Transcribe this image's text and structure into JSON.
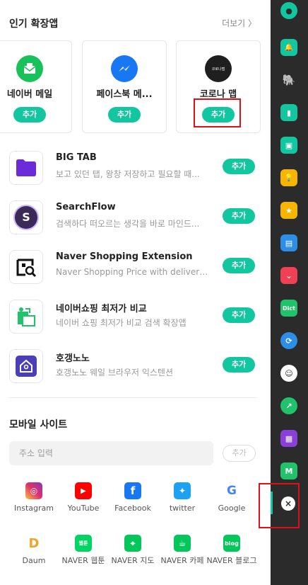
{
  "popular": {
    "title": "인기 확장앱",
    "more": "더보기 〉",
    "cards": [
      {
        "name": "네이버 메일",
        "button": "추가",
        "color": "#19c15a"
      },
      {
        "name": "페이스북 메...",
        "button": "추가",
        "color": "#1877f2"
      },
      {
        "name": "코로나 맵",
        "button": "추가",
        "color": "#1f1f1f",
        "icon_text": "코로나맵"
      }
    ]
  },
  "list": [
    {
      "title": "BIG TAB",
      "desc": "보고 있던 탭, 왕창 저장하고 필요할 때...",
      "button": "추가"
    },
    {
      "title": "SearchFlow",
      "desc": "검색하다 떠오르는 생각을 바로 마인드...",
      "button": "추가"
    },
    {
      "title": "Naver Shopping Extension",
      "desc": "Naver Shopping Price with delivery pr...",
      "button": "추가"
    },
    {
      "title": "네이버쇼핑 최저가 비교",
      "desc": "네이버 쇼핑 최저가 비교 검색 확장앱",
      "button": "추가"
    },
    {
      "title": "호갱노노",
      "desc": "호갱노노 웨일 브라우저 익스텐션",
      "button": "추가"
    }
  ],
  "mobile": {
    "title": "모바일 사이트",
    "placeholder": "주소 입력",
    "add_button": "추가",
    "sites": [
      {
        "label": "Instagram",
        "icon": "instagram-icon",
        "glyph": "◎"
      },
      {
        "label": "YouTube",
        "icon": "youtube-icon",
        "glyph": "▶"
      },
      {
        "label": "Facebook",
        "icon": "facebook-icon",
        "glyph": "f"
      },
      {
        "label": "twitter",
        "icon": "twitter-icon",
        "glyph": "✦"
      },
      {
        "label": "Google",
        "icon": "google-icon",
        "glyph": "G"
      },
      {
        "label": "Daum",
        "icon": "daum-icon",
        "glyph": "D"
      },
      {
        "label": "NAVER 웹툰",
        "icon": "naver-webtoon-icon",
        "glyph": "웹툰"
      },
      {
        "label": "NAVER 지도",
        "icon": "naver-map-icon",
        "glyph": "⌖"
      },
      {
        "label": "NAVER 카페",
        "icon": "naver-cafe-icon",
        "glyph": "☕"
      },
      {
        "label": "NAVER 블로그",
        "icon": "naver-blog-icon",
        "glyph": "blog"
      }
    ]
  },
  "sidebar": {
    "items": [
      {
        "icon": "whale-logo-icon",
        "glyph": "●"
      },
      {
        "icon": "alarm-icon",
        "glyph": "🔔"
      },
      {
        "icon": "evernote-icon",
        "glyph": "🐘"
      },
      {
        "icon": "bookmark-icon",
        "glyph": "▮"
      },
      {
        "icon": "note-icon",
        "glyph": "▣"
      },
      {
        "icon": "lightbulb-icon",
        "glyph": "💡"
      },
      {
        "icon": "star-icon",
        "glyph": "★"
      },
      {
        "icon": "wallet-icon",
        "glyph": "▤"
      },
      {
        "icon": "pocket-icon",
        "glyph": "⌄"
      },
      {
        "icon": "dictionary-icon",
        "glyph": "Dict"
      },
      {
        "icon": "translator-icon",
        "glyph": "⟳"
      },
      {
        "icon": "emoji-icon",
        "glyph": "☺"
      },
      {
        "icon": "stock-chart-icon",
        "glyph": "↗"
      },
      {
        "icon": "calendar-icon",
        "glyph": "▦"
      },
      {
        "icon": "naver-me-icon",
        "glyph": "M"
      }
    ],
    "close": "×"
  }
}
